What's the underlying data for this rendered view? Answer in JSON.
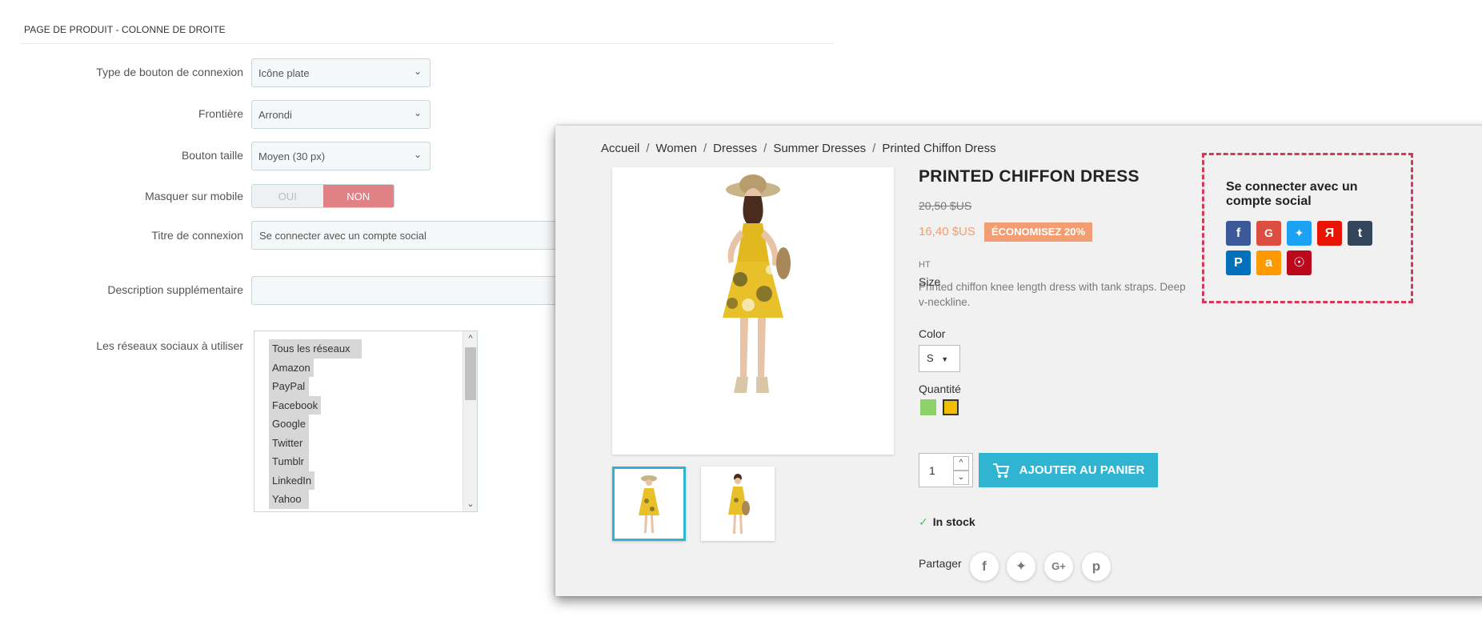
{
  "admin": {
    "section_title": "PAGE DE PRODUIT - COLONNE DE DROITE",
    "fields": {
      "button_type": {
        "label": "Type de bouton de connexion",
        "value": "Icône plate"
      },
      "border": {
        "label": "Frontière",
        "value": "Arrondi"
      },
      "button_size": {
        "label": "Bouton taille",
        "value": "Moyen (30 px)"
      },
      "hide_mobile": {
        "label": "Masquer sur mobile",
        "yes": "OUI",
        "no": "NON",
        "selected": "NON"
      },
      "login_title": {
        "label": "Titre de connexion",
        "value": "Se connecter avec un compte social"
      },
      "extra_desc": {
        "label": "Description supplémentaire",
        "value": ""
      },
      "networks": {
        "label": "Les réseaux sociaux à utiliser",
        "options": [
          "Tous les réseaux",
          "Amazon",
          "PayPal",
          "Facebook",
          "Google",
          "Twitter",
          "Tumblr",
          "LinkedIn",
          "Yahoo"
        ]
      }
    }
  },
  "store": {
    "breadcrumb": [
      "Accueil",
      "Women",
      "Dresses",
      "Summer Dresses",
      "Printed Chiffon Dress"
    ],
    "product": {
      "title": "PRINTED CHIFFON DRESS",
      "old_price": "20,50 $US",
      "new_price": "16,40 $US",
      "discount": "ÉCONOMISEZ 20%",
      "tax": "HT",
      "description": "Printed chiffon knee length dress with tank straps. Deep v-neckline.",
      "size_label": "Size",
      "size_value": "S",
      "color_label": "Color",
      "colors": [
        "#8fd169",
        "#f0c000"
      ],
      "quantity_label": "Quantité",
      "quantity_value": "1",
      "add_to_cart": "AJOUTER AU PANIER",
      "stock": "In stock",
      "share_label": "Partager"
    },
    "social_login": {
      "title": "Se connecter avec un compte social",
      "buttons": [
        {
          "name": "facebook",
          "glyph": "f",
          "color": "#3b5998"
        },
        {
          "name": "google",
          "glyph": "G",
          "color": "#dc4e41"
        },
        {
          "name": "twitter",
          "glyph": "🐦",
          "color": "#1da1f2"
        },
        {
          "name": "yandex",
          "glyph": "Я",
          "color": "#e61400"
        },
        {
          "name": "tumblr",
          "glyph": "t",
          "color": "#35465c"
        },
        {
          "name": "paypal",
          "glyph": "P",
          "color": "#0070ba"
        },
        {
          "name": "amazon",
          "glyph": "a",
          "color": "#ff9900"
        },
        {
          "name": "pinterest",
          "glyph": "p",
          "color": "#bd081c"
        }
      ]
    }
  }
}
